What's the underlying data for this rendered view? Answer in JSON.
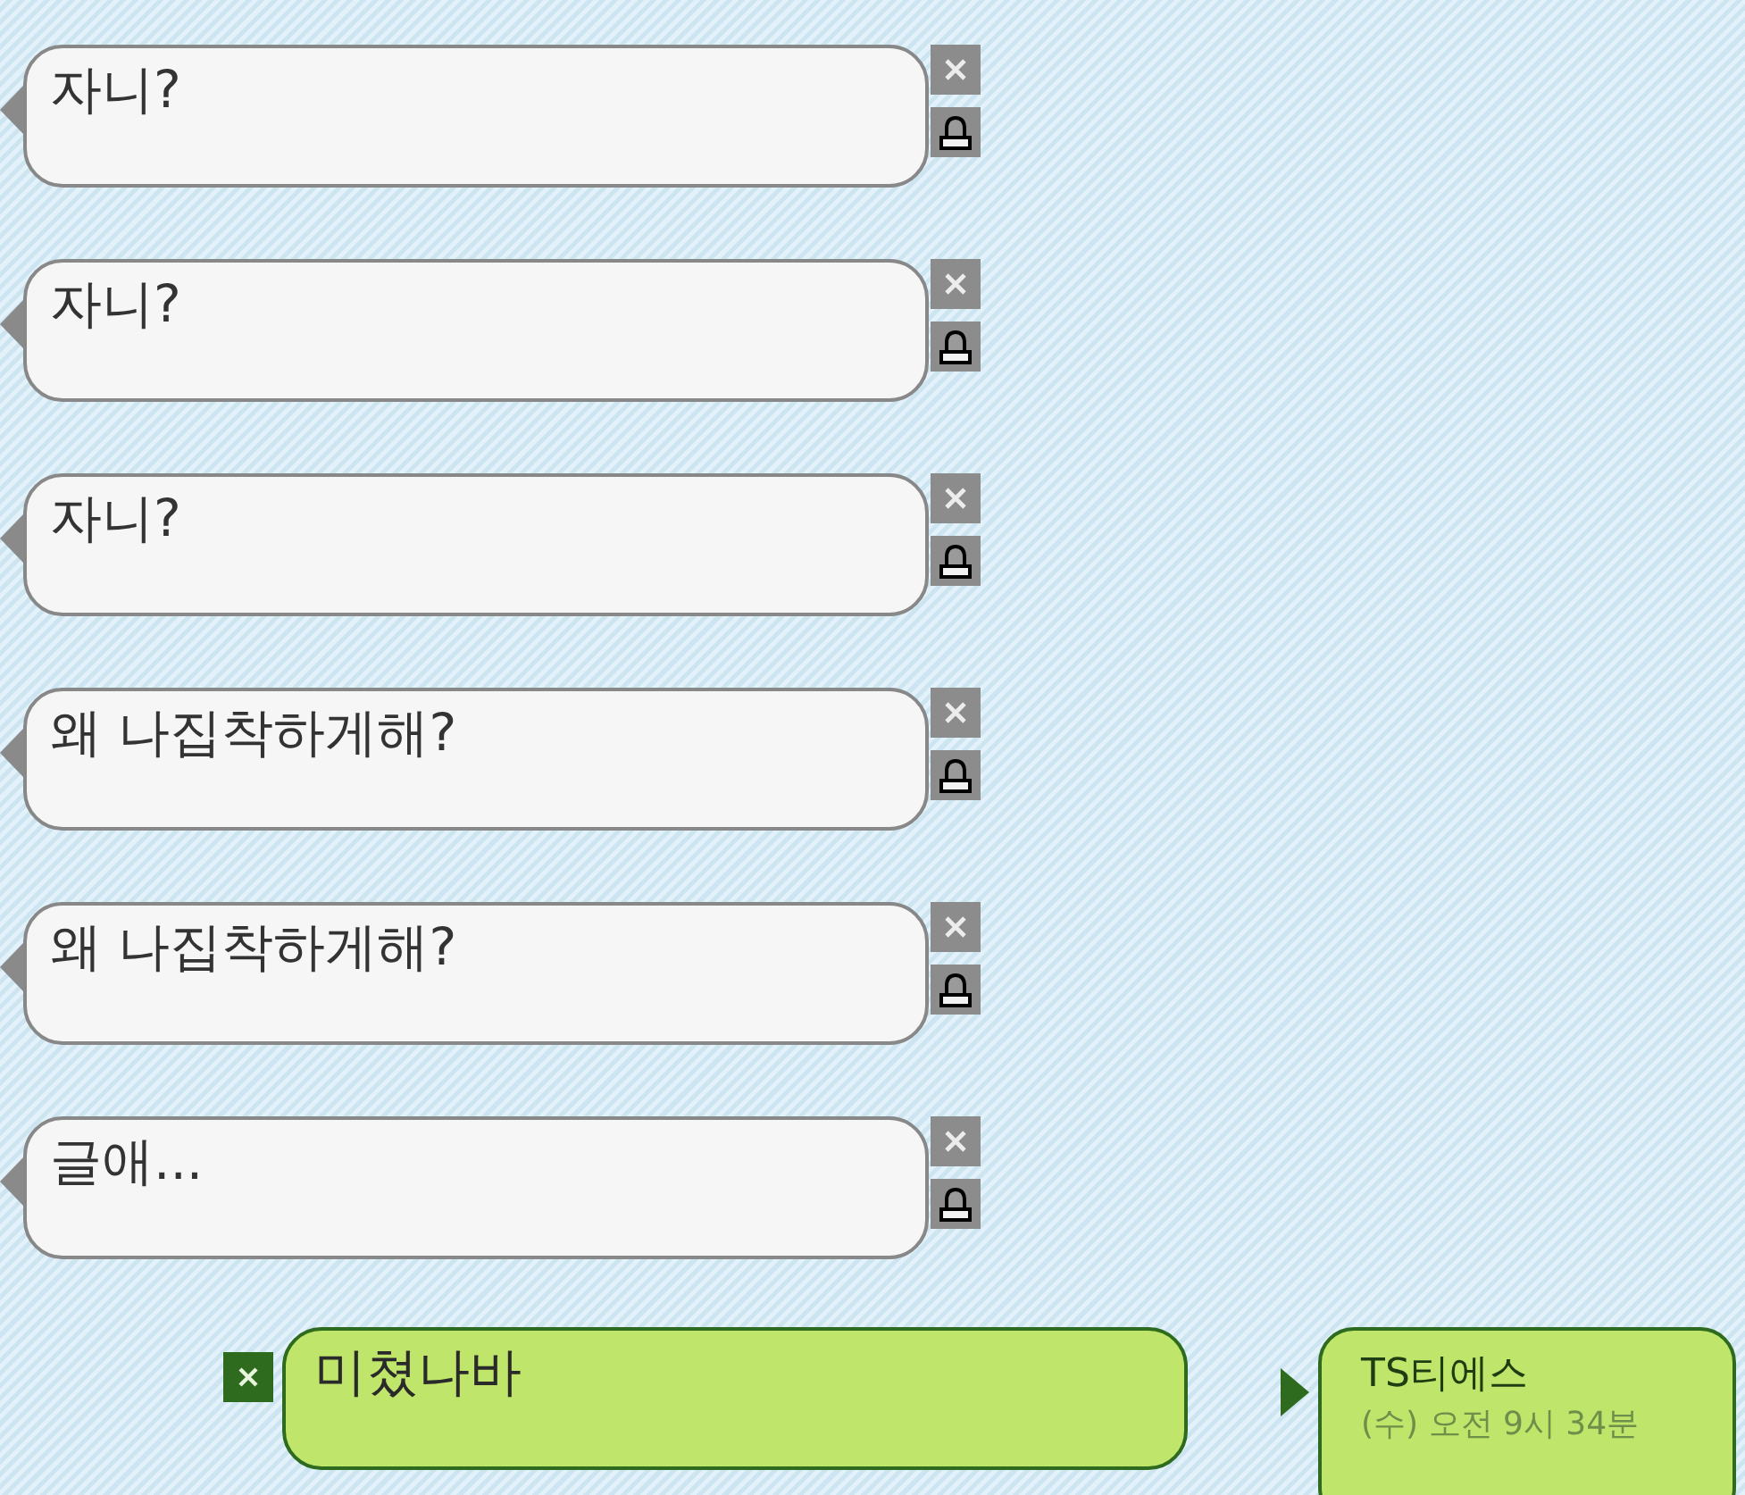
{
  "messages": [
    {
      "text": "자니?"
    },
    {
      "text": "자니?"
    },
    {
      "text": "자니?"
    },
    {
      "text": "왜 나집착하게해?"
    },
    {
      "text": "왜 나집착하게해?"
    },
    {
      "text": "글애..."
    }
  ],
  "reply": {
    "text": "미쳤나바"
  },
  "sender": {
    "name": "TS티에스",
    "time": "(수) 오전 9시 34분"
  }
}
